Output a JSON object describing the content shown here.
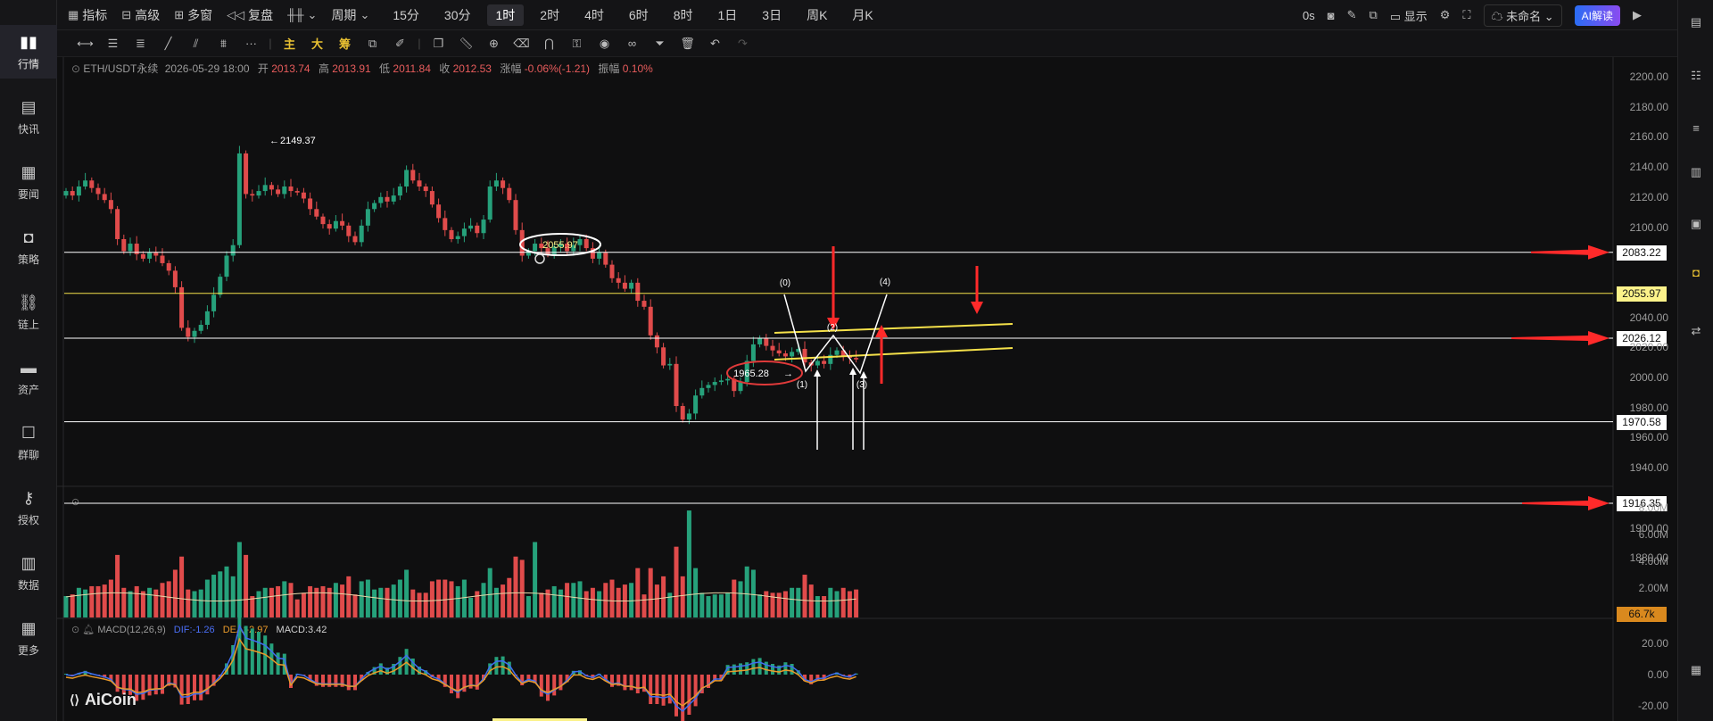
{
  "nav": {
    "items": [
      {
        "label": "行情",
        "icon": "chart-bars-icon",
        "active": true
      },
      {
        "label": "快讯",
        "icon": "news-icon"
      },
      {
        "label": "要闻",
        "icon": "document-icon"
      },
      {
        "label": "策略",
        "icon": "robot-icon"
      },
      {
        "label": "链上",
        "icon": "chain-icon"
      },
      {
        "label": "资产",
        "icon": "wallet-icon"
      },
      {
        "label": "群聊",
        "icon": "chat-icon"
      },
      {
        "label": "授权",
        "icon": "key-icon"
      },
      {
        "label": "数据",
        "icon": "data-icon"
      },
      {
        "label": "更多",
        "icon": "grid-icon"
      }
    ]
  },
  "toolbar": {
    "indicator": "指标",
    "advanced": "高级",
    "multiwindow": "多窗",
    "replay": "复盘",
    "period": "周期",
    "intervals": [
      "15分",
      "30分",
      "1时",
      "2时",
      "4时",
      "6时",
      "8时",
      "1日",
      "3日",
      "周K",
      "月K"
    ],
    "active_interval": "1时",
    "countdown": "0s",
    "display": "显示",
    "unnamed": "未命名",
    "ai": "AI解读"
  },
  "draw_tools": {
    "text_tools": [
      "主",
      "大",
      "筹"
    ]
  },
  "legend": {
    "symbol": "ETH/USDT永续",
    "datetime": "2026-05-29 18:00",
    "open_label": "开",
    "open": "2013.74",
    "high_label": "高",
    "high": "2013.91",
    "low_label": "低",
    "low": "2011.84",
    "close_label": "收",
    "close": "2012.53",
    "change_label": "涨幅",
    "change": "-0.06%(-1.21)",
    "amp_label": "振幅",
    "amp": "0.10%"
  },
  "price_axis": [
    "2200.00",
    "2180.00",
    "2160.00",
    "2140.00",
    "2120.00",
    "2100.00",
    "2083.22",
    "2055.97",
    "2040.00",
    "2026.12",
    "2020.00",
    "2000.00",
    "1980.00",
    "1970.58",
    "1960.00",
    "1940.00",
    "1916.35",
    "1900.00",
    "1880.00"
  ],
  "volume_axis": [
    "8.00M",
    "6.00M",
    "4.00M",
    "2.00M",
    "66.7k"
  ],
  "macd": {
    "params": "MACD(12,26,9)",
    "dif": "DIF:-1.26",
    "dea": "DEA:-2.97",
    "macd": "MACD:3.42",
    "axis": [
      "20.00",
      "0.00",
      "-20.00"
    ]
  },
  "annotations": {
    "high_label": "2149.37",
    "circle_label": "2055.97",
    "low_label": "1965.28",
    "wave_labels": [
      "(0)",
      "(1)",
      "(2)",
      "(3)",
      "(4)"
    ]
  },
  "levels": {
    "l1": "2083.22",
    "l2": "2055.97",
    "l3": "2026.12",
    "l4": "1970.58",
    "l5": "1916.35"
  },
  "brand": "AiCoin",
  "colors": {
    "up": "#26a17b",
    "down": "#e04b4b",
    "bg": "#0f0f10",
    "trend": "#f5e14a",
    "arrow": "#ff2a2a"
  }
}
